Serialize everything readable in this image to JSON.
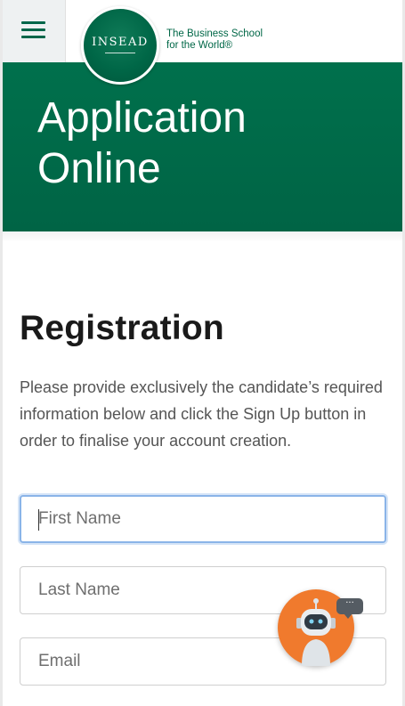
{
  "header": {
    "menu_icon": "hamburger-menu-icon",
    "logo_text": "INSEAD",
    "tagline_line1": "The Business School",
    "tagline_line2": "for the World®",
    "brand_color": "#006747"
  },
  "hero": {
    "title_line1": "Application",
    "title_line2": "Online",
    "background": "#006747"
  },
  "registration": {
    "title": "Registration",
    "description": "Please provide exclusively the candidate’s required information below and click the Sign Up button in order to finalise your account creation.",
    "fields": [
      {
        "placeholder": "First Name",
        "value": ""
      },
      {
        "placeholder": "Last Name",
        "value": ""
      },
      {
        "placeholder": "Email",
        "value": ""
      }
    ]
  },
  "chatbot": {
    "icon": "chatbot-robot-icon",
    "bubble_text": "···",
    "color": "#f07a2d"
  }
}
